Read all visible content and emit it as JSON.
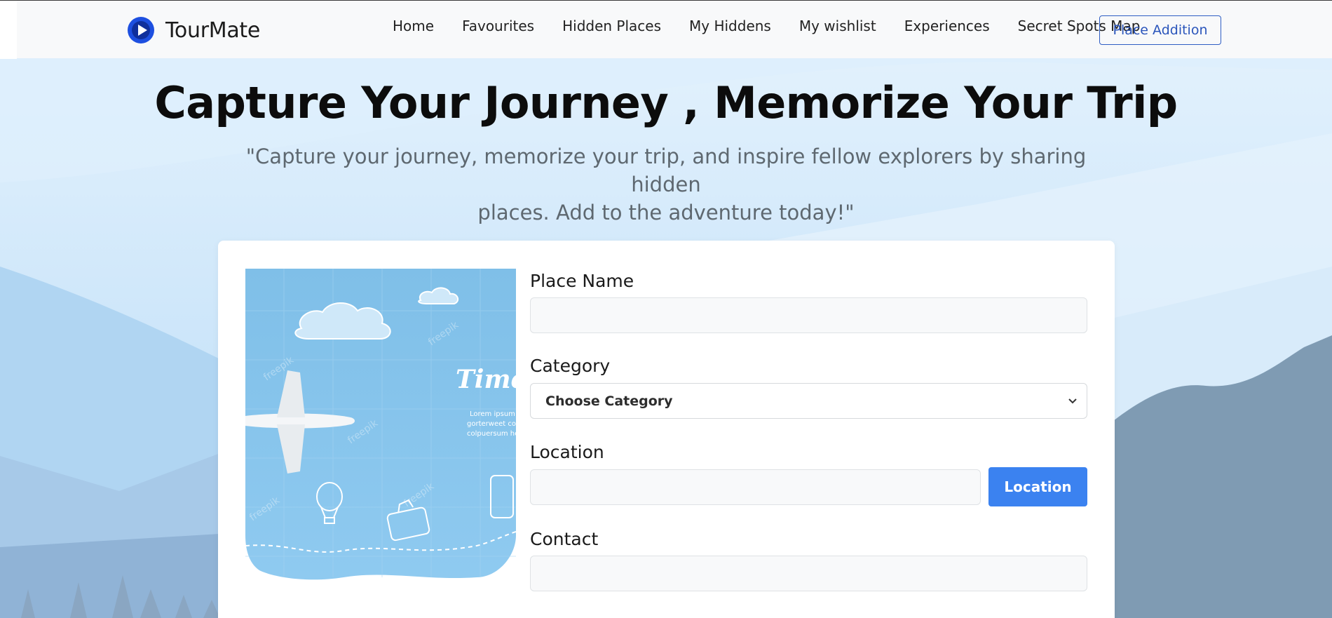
{
  "brand": {
    "name": "TourMate",
    "logo_icon": "play-circle-icon",
    "accent": "#1d4fe0"
  },
  "nav": {
    "links": [
      "Home",
      "Favourites",
      "Hidden Places",
      "My Hiddens",
      "My wishlist",
      "Experiences",
      "Secret Spots Map"
    ],
    "cta_label": "Place Addition"
  },
  "hero": {
    "title": "Capture Your Journey , Memorize Your Trip",
    "subtitle_line1": "\"Capture your journey, memorize your trip, and inspire fellow explorers by sharing hidden",
    "subtitle_line2": "places. Add to the adventure today!\""
  },
  "illustration": {
    "script_title": "Time T",
    "lines": [
      "Lorem ipsum d",
      "gorterweet co",
      "colpuersum he"
    ],
    "watermark": "freepik"
  },
  "form": {
    "place_name": {
      "label": "Place Name",
      "value": ""
    },
    "category": {
      "label": "Category",
      "selected": "Choose Category"
    },
    "location": {
      "label": "Location",
      "value": "",
      "button_label": "Location"
    },
    "contact": {
      "label": "Contact",
      "value": ""
    }
  },
  "colors": {
    "primary": "#3b82f0",
    "outline": "#2f5ec4",
    "navbar_bg": "#f8f9fa",
    "sky": "#d6ecfb",
    "mountain": "#7f9bb3"
  }
}
